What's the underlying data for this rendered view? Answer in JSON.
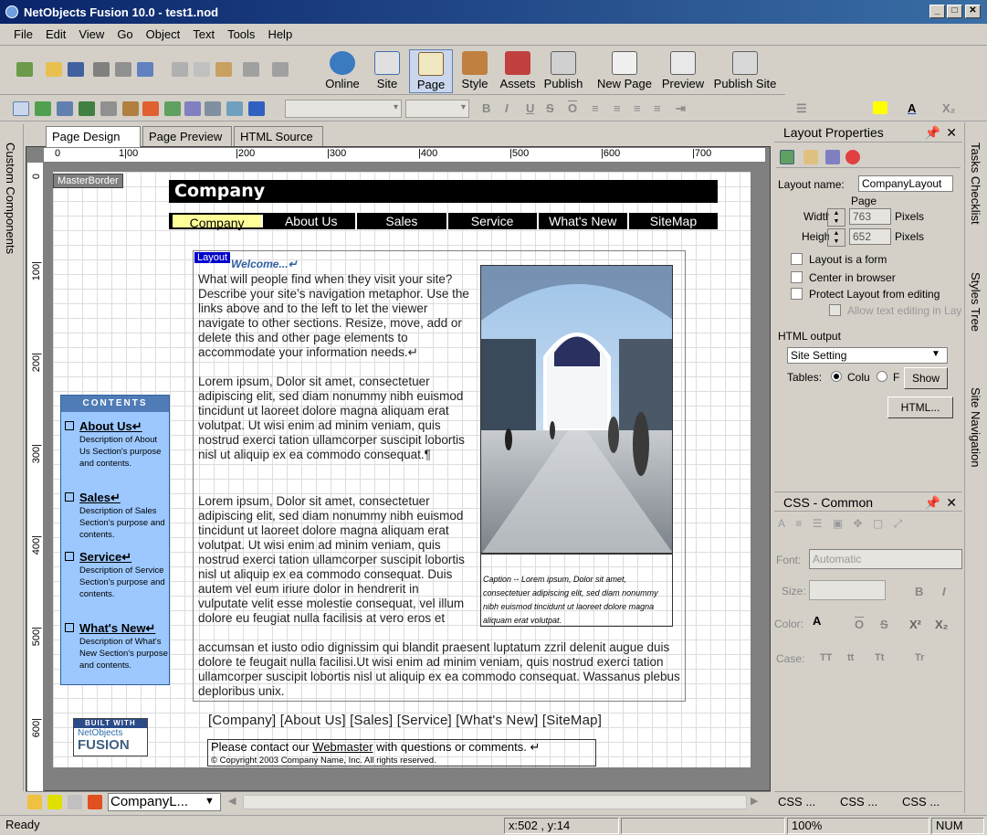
{
  "window": {
    "title": "NetObjects Fusion 10.0 - test1.nod"
  },
  "menu": [
    "File",
    "Edit",
    "View",
    "Go",
    "Object",
    "Text",
    "Tools",
    "Help"
  ],
  "toolbar": {
    "views": [
      {
        "label": "Online",
        "icon": "globe-icon"
      },
      {
        "label": "Site",
        "icon": "sitemap-icon"
      },
      {
        "label": "Page",
        "icon": "page-edit-icon"
      },
      {
        "label": "Style",
        "icon": "palette-icon"
      },
      {
        "label": "Assets",
        "icon": "assets-icon"
      },
      {
        "label": "Publish",
        "icon": "publish-icon"
      },
      {
        "label": "New Page",
        "icon": "new-page-icon"
      },
      {
        "label": "Preview",
        "icon": "preview-icon"
      },
      {
        "label": "Publish Site",
        "icon": "publish-site-icon"
      }
    ],
    "active_view": "Page"
  },
  "left_strip": {
    "label": "Custom Components"
  },
  "doc_tabs": [
    "Page Design",
    "Page Preview",
    "HTML Source"
  ],
  "rulers": {
    "h": [
      "0",
      "1|00",
      "|200",
      "|300",
      "|400",
      "|500",
      "|600",
      "|700"
    ],
    "v": [
      "0",
      "100|",
      "200|",
      "300|",
      "400|",
      "500|",
      "600|"
    ]
  },
  "page": {
    "masterborder_label": "MasterBorder",
    "banner": "Company",
    "nav": [
      "Company",
      "About Us",
      "Sales",
      "Service",
      "What's New",
      "SiteMap"
    ],
    "layout_label": "Layout",
    "welcome": "Welcome...↵",
    "para1": "What will people find when they visit your site? Describe your site’s navigation metaphor. Use the links above and to the left to let the viewer navigate to other sections. Resize, move, add or delete this and other page elements to accommodate your information needs.↵",
    "para2": "Lorem ipsum, Dolor sit amet, consectetuer adipiscing elit, sed diam nonummy nibh euismod tincidunt ut laoreet dolore magna aliquam erat volutpat. Ut wisi enim ad minim veniam, quis nostrud exerci tation ullamcorper suscipit lobortis nisl ut aliquip ex ea commodo consequat.¶",
    "para3a": "Lorem ipsum, Dolor sit amet, consectetuer adipiscing elit, sed diam nonummy nibh euismod tincidunt ut laoreet dolore magna aliquam erat volutpat. Ut wisi enim ad minim veniam, quis nostrud exerci tation ullamcorper suscipit lobortis nisl ut aliquip ex ea commodo consequat. Duis autem vel eum iriure dolor in hendrerit in vulputate velit esse molestie consequat, vel illum dolore eu feugiat nulla facilisis at vero eros et",
    "para3b": "accumsan et iusto odio dignissim qui blandit praesent luptatum zzril delenit augue duis dolore te feugait nulla facilisi.Ut wisi enim ad minim veniam, quis nostrud exerci tation ullamcorper suscipit lobortis nisl ut aliquip ex ea commodo consequat. Wassanus plebus deploribus unix.",
    "caption": "Caption -- Lorem ipsum, Dolor sit amet, consectetuer adipiscing elit, sed diam nonummy nibh euismod tincidunt ut laoreet dolore magna aliquam erat volutpat.",
    "contents": {
      "header": "CONTENTS",
      "items": [
        {
          "title": "About Us↵",
          "desc": "Description of About Us Section's purpose and contents."
        },
        {
          "title": "Sales↵",
          "desc": "Description of Sales Section's purpose and contents."
        },
        {
          "title": "Service↵",
          "desc": "Description of Service Section's purpose and contents."
        },
        {
          "title": "What's New↵",
          "desc": "Description of What's New Section's purpose and contents."
        }
      ]
    },
    "footer_nav": "[Company] [About Us] [Sales] [Service] [What's New] [SiteMap]",
    "badge": {
      "line1": "BUILT WITH",
      "line2": "NetObjects",
      "line3": "FUSION"
    },
    "contact_pre": "Please contact our ",
    "contact_link": "Webmaster",
    "contact_post": " with questions or comments. ↵",
    "copyright": "© Copyright 2003 Company Name, Inc.  All rights reserved."
  },
  "bottom": {
    "layout_select": "CompanyL..."
  },
  "layout_props": {
    "title": "Layout Properties",
    "layout_name_label": "Layout name:",
    "layout_name": "CompanyLayout",
    "page_label": "Page",
    "width_label": "Width",
    "width": "763",
    "height_label": "Height",
    "height": "652",
    "pixels": "Pixels",
    "opt_form": "Layout is a form",
    "opt_center": "Center in browser",
    "opt_protect": "Protect Layout from editing",
    "opt_allow": "Allow text editing in Layout",
    "html_output_label": "HTML output",
    "html_output": "Site Setting",
    "tables_label": "Tables:",
    "radio_cols": "Colu",
    "radio_f": "F",
    "show_btn": "Show",
    "html_btn": "HTML..."
  },
  "css_panel": {
    "title": "CSS - Common",
    "font_label": "Font:",
    "font_value": "Automatic",
    "size_label": "Size:",
    "color_label": "Color:",
    "case_label": "Case:",
    "case_opts": [
      "TT",
      "tt",
      "Tt",
      "Tr"
    ],
    "tabs": [
      "CSS ...",
      "CSS ...",
      "CSS ..."
    ]
  },
  "right_strip": [
    "Tasks Checklist",
    "Styles Tree",
    "Site Navigation"
  ],
  "status": {
    "left": "Ready",
    "coords": "x:502 , y:14",
    "zoom": "100%",
    "num": "NUM"
  }
}
